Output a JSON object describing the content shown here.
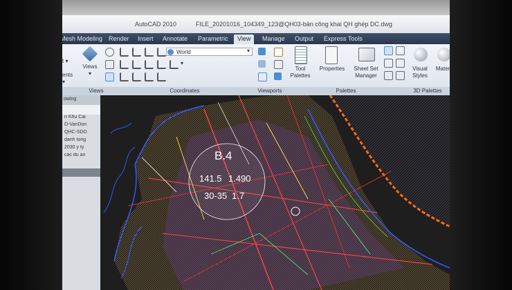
{
  "window": {
    "app_name": "AutoCAD 2010",
    "file_title": "FILE_20201016_104349_123@QH03-bản công khai QH ghép DC.dwg"
  },
  "tabs": [
    {
      "label": "Mesh Modeling"
    },
    {
      "label": "Render"
    },
    {
      "label": "Insert"
    },
    {
      "label": "Annotate"
    },
    {
      "label": "Parametric"
    },
    {
      "label": "View"
    },
    {
      "label": "Manage"
    },
    {
      "label": "Output"
    },
    {
      "label": "Express Tools"
    }
  ],
  "active_tab": "View",
  "ribbon": {
    "views_button": "Views",
    "coordinates_dropdown": "World",
    "panels": [
      "Views",
      "Coordinates",
      "Viewports",
      "Palettes",
      "3D Palettes"
    ],
    "tool_palettes": "Tool Palettes",
    "properties": "Properties",
    "sheet_set_manager": "Sheet Set Manager",
    "visual_styles": "Visual Styles",
    "materials": "Materi"
  },
  "left_panel": {
    "header": "owing",
    "items": [
      "n Khu Cai",
      "D-VanDon",
      "QHC-SDD",
      "danh tong",
      "2030 y ty",
      "cac du an"
    ]
  },
  "drawing_labels": {
    "zone": "B.4",
    "area": "141.5",
    "population": "1.490",
    "height": "30-35",
    "ratio": "1.7"
  },
  "colors": {
    "ribbon_bg": "#e4e9ef",
    "tab_bar": "#2f3d55",
    "canvas_bg": "#1f1f1f",
    "coast_line": "#ff6a1a"
  }
}
